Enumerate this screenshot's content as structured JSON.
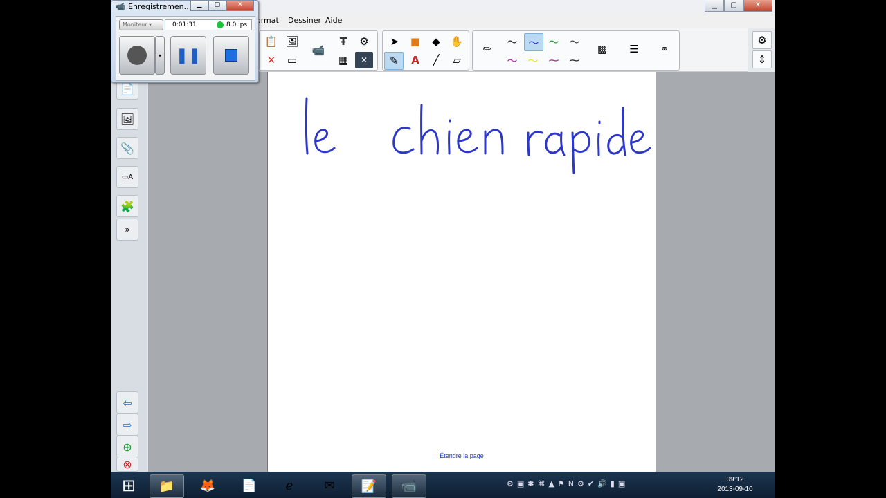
{
  "recorder": {
    "title": "Enregistremen…",
    "source_label": "Moniteur",
    "elapsed_time": "0:01:31",
    "fps": "8.0 ips",
    "status_color": "#19c33a"
  },
  "menubar": {
    "items": [
      "ormat",
      "Dessiner",
      "Aide"
    ]
  },
  "page": {
    "handwriting": "le  chien  rapide",
    "ink_color": "#2d37c8",
    "extend_link": "Étendre la page"
  },
  "taskbar": {
    "clock_time": "09:12",
    "clock_date": "2013-09-10"
  }
}
